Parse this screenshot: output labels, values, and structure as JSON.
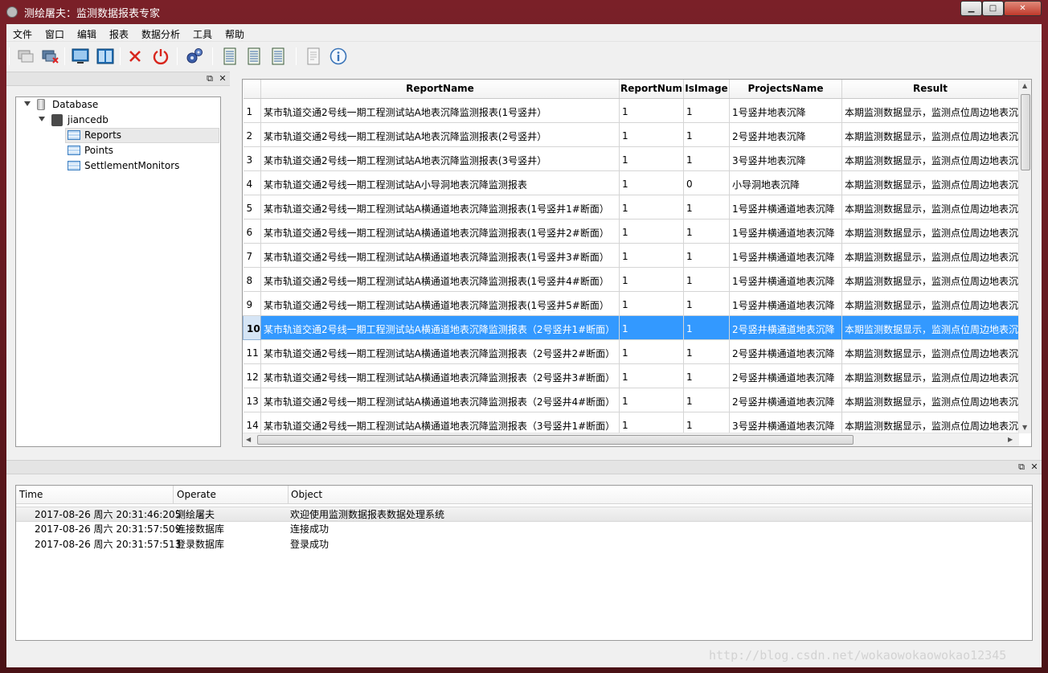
{
  "window": {
    "title": "测绘屠夫：监测数据报表专家",
    "controls": [
      "minimize",
      "maximize",
      "close"
    ]
  },
  "menubar": {
    "items": [
      "文件",
      "窗口",
      "编辑",
      "报表",
      "数据分析",
      "工具",
      "帮助"
    ]
  },
  "toolbar": {
    "icons": [
      "connect-icon",
      "disconnect-icon",
      "view-icon",
      "split-view-icon",
      "delete-icon",
      "power-icon",
      "settings-icon",
      "report-icon",
      "report-2-icon",
      "report-3-icon",
      "export-icon",
      "info-icon"
    ]
  },
  "tree": {
    "root": "Database",
    "db": "jiancedb",
    "tables": [
      "Reports",
      "Points",
      "SettlementMonitors"
    ],
    "selected": "Reports"
  },
  "grid": {
    "columns": [
      "ReportName",
      "ReportNum",
      "IsImage",
      "ProjectsName",
      "Result"
    ],
    "selected_row": 10,
    "rows": [
      {
        "n": "1",
        "name": "某市轨道交通2号线一期工程测试站A地表沉降监测报表(1号竖井）",
        "num": "1",
        "img": "1",
        "proj": "1号竖井地表沉降",
        "result": "本期监测数据显示，监测点位周边地表沉"
      },
      {
        "n": "2",
        "name": "某市轨道交通2号线一期工程测试站A地表沉降监测报表(2号竖井）",
        "num": "1",
        "img": "1",
        "proj": "2号竖井地表沉降",
        "result": "本期监测数据显示，监测点位周边地表沉"
      },
      {
        "n": "3",
        "name": "某市轨道交通2号线一期工程测试站A地表沉降监测报表(3号竖井）",
        "num": "1",
        "img": "1",
        "proj": "3号竖井地表沉降",
        "result": "本期监测数据显示，监测点位周边地表沉"
      },
      {
        "n": "4",
        "name": "某市轨道交通2号线一期工程测试站A小导洞地表沉降监测报表",
        "num": "1",
        "img": "0",
        "proj": "小导洞地表沉降",
        "result": "本期监测数据显示，监测点位周边地表沉"
      },
      {
        "n": "5",
        "name": "某市轨道交通2号线一期工程测试站A横通道地表沉降监测报表(1号竖井1#断面）",
        "num": "1",
        "img": "1",
        "proj": "1号竖井横通道地表沉降",
        "result": "本期监测数据显示，监测点位周边地表沉"
      },
      {
        "n": "6",
        "name": "某市轨道交通2号线一期工程测试站A横通道地表沉降监测报表(1号竖井2#断面）",
        "num": "1",
        "img": "1",
        "proj": "1号竖井横通道地表沉降",
        "result": "本期监测数据显示，监测点位周边地表沉"
      },
      {
        "n": "7",
        "name": "某市轨道交通2号线一期工程测试站A横通道地表沉降监测报表(1号竖井3#断面）",
        "num": "1",
        "img": "1",
        "proj": "1号竖井横通道地表沉降",
        "result": "本期监测数据显示，监测点位周边地表沉"
      },
      {
        "n": "8",
        "name": "某市轨道交通2号线一期工程测试站A横通道地表沉降监测报表(1号竖井4#断面）",
        "num": "1",
        "img": "1",
        "proj": "1号竖井横通道地表沉降",
        "result": "本期监测数据显示，监测点位周边地表沉"
      },
      {
        "n": "9",
        "name": "某市轨道交通2号线一期工程测试站A横通道地表沉降监测报表(1号竖井5#断面）",
        "num": "1",
        "img": "1",
        "proj": "1号竖井横通道地表沉降",
        "result": "本期监测数据显示，监测点位周边地表沉"
      },
      {
        "n": "10",
        "name": "某市轨道交通2号线一期工程测试站A横通道地表沉降监测报表（2号竖井1#断面）",
        "num": "1",
        "img": "1",
        "proj": "2号竖井横通道地表沉降",
        "result": "本期监测数据显示，监测点位周边地表沉"
      },
      {
        "n": "11",
        "name": "某市轨道交通2号线一期工程测试站A横通道地表沉降监测报表（2号竖井2#断面）",
        "num": "1",
        "img": "1",
        "proj": "2号竖井横通道地表沉降",
        "result": "本期监测数据显示，监测点位周边地表沉"
      },
      {
        "n": "12",
        "name": "某市轨道交通2号线一期工程测试站A横通道地表沉降监测报表（2号竖井3#断面）",
        "num": "1",
        "img": "1",
        "proj": "2号竖井横通道地表沉降",
        "result": "本期监测数据显示，监测点位周边地表沉"
      },
      {
        "n": "13",
        "name": "某市轨道交通2号线一期工程测试站A横通道地表沉降监测报表（2号竖井4#断面）",
        "num": "1",
        "img": "1",
        "proj": "2号竖井横通道地表沉降",
        "result": "本期监测数据显示，监测点位周边地表沉"
      },
      {
        "n": "14",
        "name": "某市轨道交通2号线一期工程测试站A横通道地表沉降监测报表（3号竖井1#断面）",
        "num": "1",
        "img": "1",
        "proj": "3号竖井横通道地表沉降",
        "result": "本期监测数据显示，监测点位周边地表沉"
      }
    ]
  },
  "log": {
    "columns": [
      "Time",
      "Operate",
      "Object"
    ],
    "rows": [
      {
        "time": "2017-08-26 周六 20:31:46:205",
        "op": "测绘屠夫",
        "obj": "欢迎使用监测数据报表数据处理系统"
      },
      {
        "time": "2017-08-26 周六 20:31:57:509",
        "op": "连接数据库",
        "obj": "连接成功"
      },
      {
        "time": "2017-08-26 周六 20:31:57:513",
        "op": "登录数据库",
        "obj": "登录成功"
      }
    ]
  },
  "watermark": "http://blog.csdn.net/wokaowokaowokao12345"
}
